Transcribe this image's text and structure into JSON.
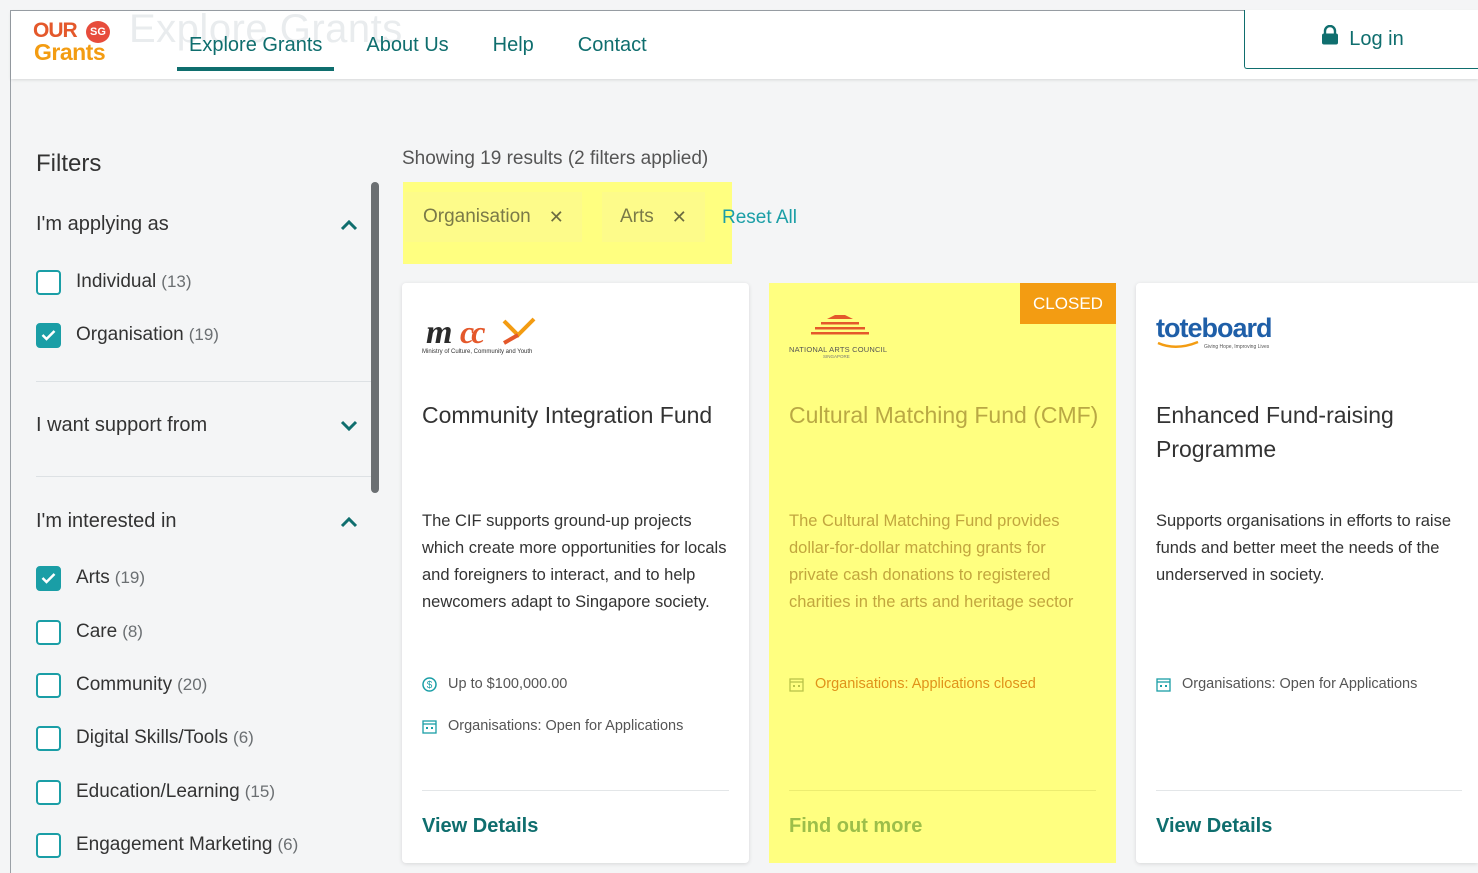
{
  "header": {
    "logo_our": "OUR",
    "logo_sg": "SG",
    "logo_grants": "Grants",
    "ghost_title": "Explore Grants",
    "nav": [
      {
        "label": "Explore Grants",
        "active": true
      },
      {
        "label": "About Us"
      },
      {
        "label": "Help"
      },
      {
        "label": "Contact"
      }
    ],
    "login_label": "Log in"
  },
  "sidebar": {
    "title": "Filters",
    "sections": [
      {
        "title": "I'm applying as",
        "expanded": true,
        "options": [
          {
            "label": "Individual",
            "count": "(13)",
            "checked": false
          },
          {
            "label": "Organisation",
            "count": "(19)",
            "checked": true
          }
        ]
      },
      {
        "title": "I want support from",
        "expanded": false
      },
      {
        "title": "I'm interested in",
        "expanded": true,
        "options": [
          {
            "label": "Arts",
            "count": "(19)",
            "checked": true
          },
          {
            "label": "Care",
            "count": "(8)",
            "checked": false
          },
          {
            "label": "Community",
            "count": "(20)",
            "checked": false
          },
          {
            "label": "Digital Skills/Tools",
            "count": "(6)",
            "checked": false
          },
          {
            "label": "Education/Learning",
            "count": "(15)",
            "checked": false
          },
          {
            "label": "Engagement Marketing",
            "count": "(6)",
            "checked": false
          }
        ]
      }
    ]
  },
  "results": {
    "summary": "Showing 19 results (2 filters applied)",
    "chips": [
      "Organisation",
      "Arts"
    ],
    "chip_close": "✕",
    "reset_label": "Reset All"
  },
  "cards": [
    {
      "logo": "MCCY",
      "logo_sub": "Ministry of Culture, Community and Youth",
      "title": "Community Integration Fund",
      "description": "The CIF supports ground-up projects which create more opportunities for locals and foreigners to interact, and to help newcomers adapt to Singapore society.",
      "amount": "Up to $100,000.00",
      "status": "Organisations: Open for Applications",
      "cta": "View Details",
      "highlighted": false
    },
    {
      "logo": "NATIONAL ARTS COUNCIL",
      "logo_sub": "SINGAPORE",
      "badge": "CLOSED",
      "title": "Cultural Matching Fund (CMF)",
      "description": "The Cultural Matching Fund provides dollar-for-dollar matching grants for private cash donations to registered charities in the arts and heritage sector",
      "status": "Organisations: Applications closed",
      "cta": "Find out more",
      "highlighted": true
    },
    {
      "logo": "toteboard",
      "logo_sub": "Giving Hope, Improving Lives",
      "title": "Enhanced Fund-raising Programme",
      "description": "Supports organisations in efforts to raise funds and better meet the needs of the underserved in society.",
      "status": "Organisations: Open for Applications",
      "cta": "View Details",
      "highlighted": false
    }
  ],
  "colors": {
    "brand_teal": "#0f6e6e",
    "checkbox_teal": "#1a9ea6",
    "closed_orange": "#f39c12",
    "highlight_yellow": "#ffff80"
  },
  "icons": [
    "lock-icon",
    "chevron-up-icon",
    "chevron-down-icon",
    "checkmark-icon",
    "close-icon",
    "dollar-icon",
    "calendar-icon"
  ]
}
